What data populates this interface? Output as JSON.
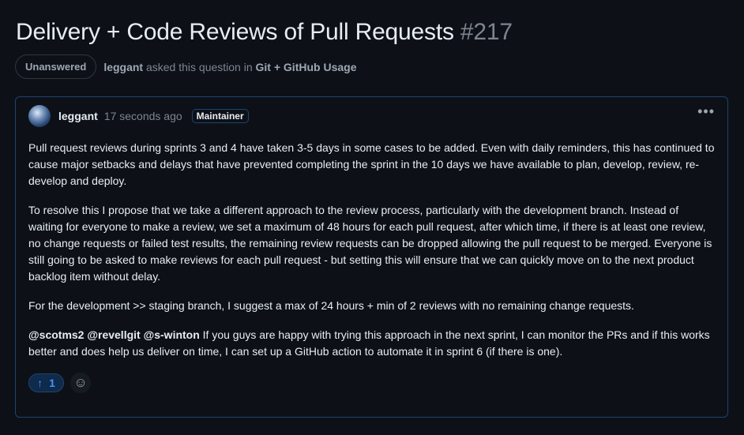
{
  "header": {
    "title": "Delivery + Code Reviews of Pull Requests",
    "number": "#217"
  },
  "meta": {
    "status": "Unanswered",
    "author": "leggant",
    "asked_text": "asked this question in",
    "category": "Git + GitHub Usage"
  },
  "post": {
    "author": "leggant",
    "time": "17 seconds ago",
    "role": "Maintainer",
    "more_icon": "kebab-horizontal-icon",
    "paragraphs": [
      "Pull request reviews during sprints 3 and 4 have taken 3-5 days in some cases to be added. Even with daily reminders, this has continued to cause major setbacks and delays that have prevented completing the sprint in the 10 days we have available to plan, develop, review, re-develop and deploy.",
      "To resolve this I propose that we take a different approach to the review process, particularly with the development branch. Instead of waiting for everyone to make a review, we set a maximum of 48 hours for each pull request, after which time, if there is at least one review, no change requests or failed test results, the remaining review requests can be dropped allowing the pull request to be merged. Everyone is still going to be asked to make reviews for each pull request - but setting this will ensure that we can quickly move on to the next product backlog item without delay.",
      "For the development >> staging branch, I suggest a max of 24 hours + min of 2 reviews with no remaining change requests."
    ],
    "mentions": "@scotms2 @revellgit @s-winton",
    "last_paragraph": " If you guys are happy with trying this approach in the next sprint, I can monitor the PRs and if this works better and does help us deliver on time, I can set up a GitHub action to automate it in sprint 6 (if there is one).",
    "upvotes": "1"
  }
}
